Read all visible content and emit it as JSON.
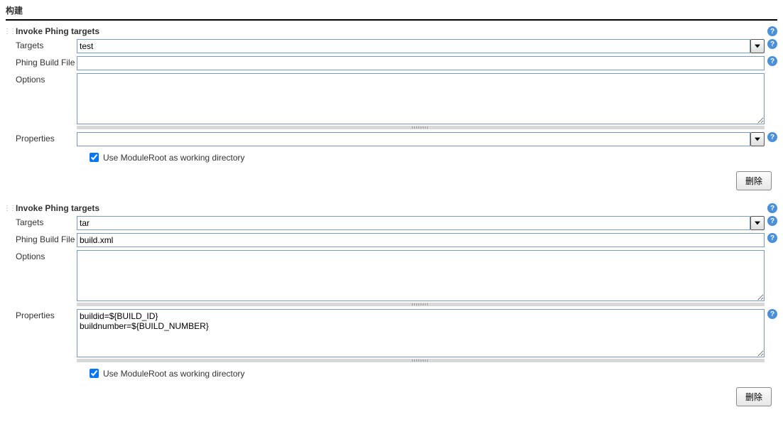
{
  "sectionHeader": "构建",
  "help_glyph": "?",
  "deleteLabel": "删除",
  "steps": [
    {
      "title": "Invoke Phing targets",
      "targets": {
        "label": "Targets",
        "value": "test"
      },
      "buildFile": {
        "label": "Phing Build File",
        "value": ""
      },
      "options": {
        "label": "Options",
        "value": ""
      },
      "properties": {
        "label": "Properties",
        "value": ""
      },
      "moduleRoot": {
        "label": "Use ModuleRoot as working directory",
        "checked": true
      }
    },
    {
      "title": "Invoke Phing targets",
      "targets": {
        "label": "Targets",
        "value": "tar"
      },
      "buildFile": {
        "label": "Phing Build File",
        "value": "build.xml"
      },
      "options": {
        "label": "Options",
        "value": ""
      },
      "properties": {
        "label": "Properties",
        "value": "buildid=${BUILD_ID}\nbuildnumber=${BUILD_NUMBER}"
      },
      "moduleRoot": {
        "label": "Use ModuleRoot as working directory",
        "checked": true
      }
    }
  ]
}
